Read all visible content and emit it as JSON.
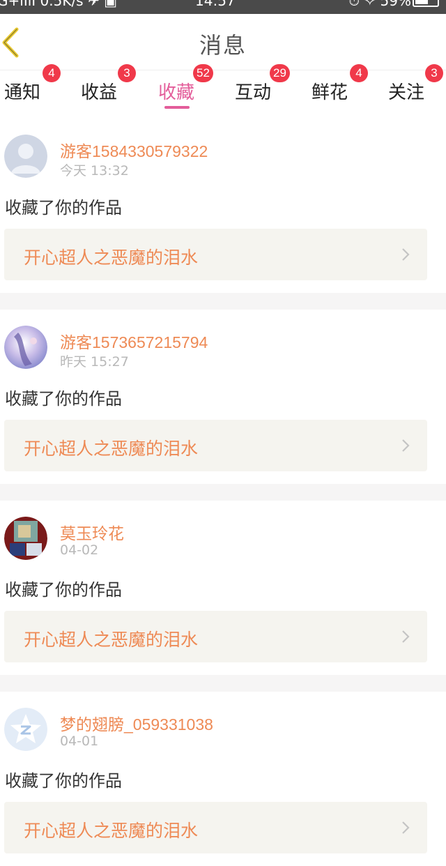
{
  "status_bar": {
    "left": "G+ıIlI 0.5K/s ✈ ▣",
    "time": "14:57",
    "right": "⏱ ✧ 59%"
  },
  "header": {
    "title": "消息",
    "back_icon": "chevron-left-icon",
    "back_color": "#e8c930"
  },
  "tabs": [
    {
      "label": "通知",
      "badge": "4",
      "active": false
    },
    {
      "label": "收益",
      "badge": "3",
      "active": false
    },
    {
      "label": "收藏",
      "badge": "52",
      "active": true
    },
    {
      "label": "互动",
      "badge": "29",
      "active": false
    },
    {
      "label": "鲜花",
      "badge": "4",
      "active": false
    },
    {
      "label": "关注",
      "badge": "3",
      "active": false
    }
  ],
  "colors": {
    "accent": "#e35d9a",
    "badge": "#f0394a",
    "username": "#ee8a55",
    "card_bg": "#f5f4ef"
  },
  "messages": [
    {
      "username": "游客1584330579322",
      "time": "今天 13:32",
      "action": "收藏了你的作品",
      "work_title": "开心超人之恶魔的泪水",
      "avatar": "default-avatar-icon"
    },
    {
      "username": "游客1573657215794",
      "time": "昨天 15:27",
      "action": "收藏了你的作品",
      "work_title": "开心超人之恶魔的泪水",
      "avatar": "illustration-avatar"
    },
    {
      "username": "莫玉玲花",
      "time": "04-02",
      "action": "收藏了你的作品",
      "work_title": "开心超人之恶魔的泪水",
      "avatar": "photo-avatar"
    },
    {
      "username": "梦的翅膀_059331038",
      "time": "04-01",
      "action": "收藏了你的作品",
      "work_title": "开心超人之恶魔的泪水",
      "avatar": "qzone-avatar-icon"
    }
  ]
}
